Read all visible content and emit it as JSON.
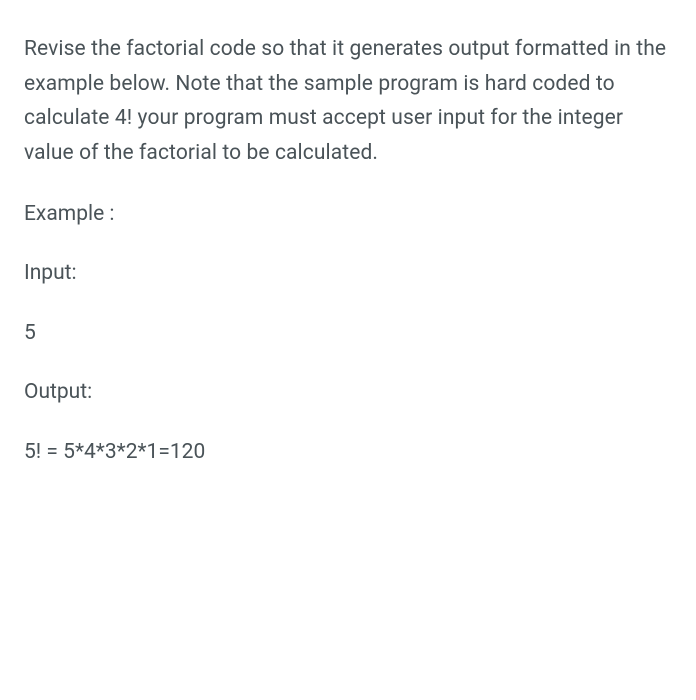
{
  "problem": {
    "description": "Revise the factorial code so that it generates output formatted  in the example below. Note that the sample program is hard coded to calculate 4! your program must accept user input for the integer value of the factorial to be calculated.",
    "example_label": "Example :",
    "input_label": "Input:",
    "input_value": "5",
    "output_label": "Output:",
    "output_value": "5! = 5*4*3*2*1=120"
  }
}
